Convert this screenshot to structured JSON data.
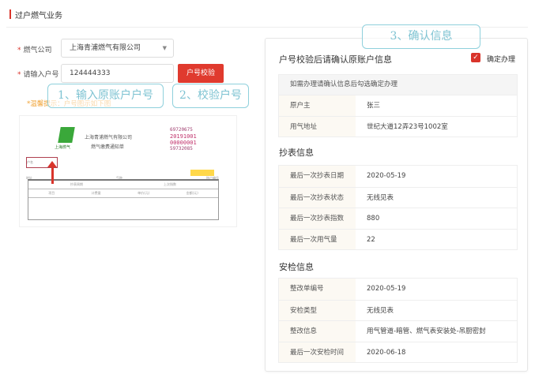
{
  "header": {
    "title": "过户燃气业务"
  },
  "form": {
    "company_label": "燃气公司",
    "company_value": "上海青浦燃气有限公司",
    "account_label": "请输入户号",
    "account_value": "124444333",
    "verify_button": "户号校验",
    "tip": "*温馨提示：户号图示如下图"
  },
  "annotations": {
    "step1": "1、输入原账户户号",
    "step2": "2、校验户号",
    "step3": "3、确认信息"
  },
  "bill": {
    "company": "上海青浦燃气有限公司",
    "title": "燃气缴费通知单",
    "logo": "上海燃气",
    "numbers": [
      "69720675",
      "20191001",
      "00000001",
      "59732085"
    ],
    "fields": [
      "户名",
      "地址",
      "账户编号",
      "气种",
      "抄表周期",
      "上次指数",
      "项目",
      "计费量",
      "单价(元)",
      "金额(元)"
    ]
  },
  "confirm": {
    "title": "户号校验后请确认原账户信息",
    "checkbox_label": "确定办理",
    "checked": true,
    "note": "如需办理请确认信息后勾选确定办理",
    "owner": [
      {
        "k": "原户主",
        "v": "张三"
      },
      {
        "k": "用气地址",
        "v": "世纪大道12弄23号1002室"
      }
    ],
    "meter_title": "抄表信息",
    "meter": [
      {
        "k": "最后一次抄表日期",
        "v": "2020-05-19"
      },
      {
        "k": "最后一次抄表状态",
        "v": "无线见表"
      },
      {
        "k": "最后一次抄表指数",
        "v": "880"
      },
      {
        "k": "最后一次用气量",
        "v": "22"
      }
    ],
    "safety_title": "安检信息",
    "safety": [
      {
        "k": "整改单编号",
        "v": "2020-05-19"
      },
      {
        "k": "安检类型",
        "v": "无线见表"
      },
      {
        "k": "整改信息",
        "v": "用气管道-暗管、燃气表安装处-吊厨密封"
      },
      {
        "k": "最后一次安检时间",
        "v": "2020-06-18"
      }
    ]
  }
}
